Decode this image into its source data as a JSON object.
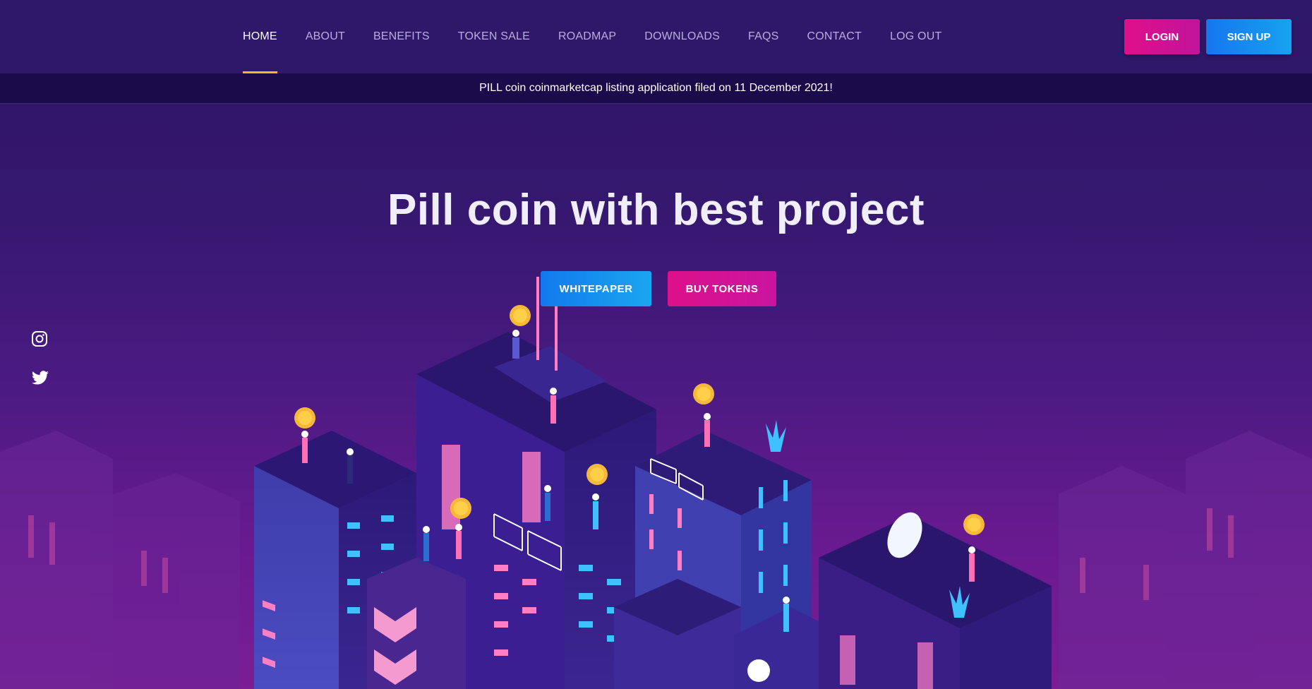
{
  "nav": {
    "items": [
      {
        "label": "HOME",
        "active": true
      },
      {
        "label": "ABOUT"
      },
      {
        "label": "BENEFITS"
      },
      {
        "label": "TOKEN SALE"
      },
      {
        "label": "ROADMAP"
      },
      {
        "label": "DOWNLOADS"
      },
      {
        "label": "FAQS"
      },
      {
        "label": "CONTACT"
      },
      {
        "label": "LOG OUT"
      }
    ],
    "login_label": "LOGIN",
    "signup_label": "SIGN UP"
  },
  "announcement": "PILL coin coinmarketcap listing application filed on 11 December 2021!",
  "hero": {
    "title": "Pill coin with best project",
    "whitepaper_label": "WHITEPAPER",
    "buy_label": "BUY TOKENS"
  },
  "social": {
    "icons": [
      "instagram-icon",
      "twitter-icon"
    ]
  },
  "colors": {
    "accent_underline": "#f5b921",
    "pink": "#d6128f",
    "blue": "#168bf0",
    "background": "#2e1366"
  }
}
